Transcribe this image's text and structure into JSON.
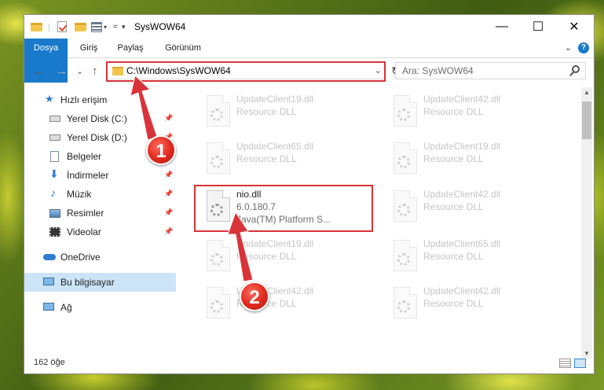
{
  "window": {
    "title": "SysWOW64"
  },
  "titlebar": {
    "minimize": "—",
    "maximize": "☐",
    "close": "✕"
  },
  "ribbon": {
    "tabs": [
      "Dosya",
      "Giriş",
      "Paylaş",
      "Görünüm"
    ],
    "help": "?",
    "collapse": "⌄"
  },
  "nav": {
    "back": "←",
    "forward": "→",
    "recent": "⌄",
    "up": "↑",
    "address": "C:\\Windows\\SysWOW64",
    "address_dropdown": "⌄",
    "refresh": "↻",
    "search_placeholder": "Ara: SysWOW64"
  },
  "sidebar": {
    "items": [
      {
        "label": "Hızlı erişim",
        "icon": "star-icon"
      },
      {
        "label": "Yerel Disk (C:)",
        "icon": "drive-icon",
        "pinned": true
      },
      {
        "label": "Yerel Disk (D:)",
        "icon": "drive-icon",
        "pinned": true
      },
      {
        "label": "Belgeler",
        "icon": "documents-icon",
        "pinned": true
      },
      {
        "label": "İndirmeler",
        "icon": "download-icon",
        "pinned": true
      },
      {
        "label": "Müzik",
        "icon": "music-icon",
        "pinned": true
      },
      {
        "label": "Resimler",
        "icon": "pictures-icon",
        "pinned": true
      },
      {
        "label": "Videolar",
        "icon": "videos-icon",
        "pinned": true
      },
      {
        "label": "OneDrive",
        "icon": "cloud-icon"
      },
      {
        "label": "Bu bilgisayar",
        "icon": "computer-icon",
        "selected": true
      },
      {
        "label": "Ağ",
        "icon": "network-icon"
      }
    ]
  },
  "files": {
    "left": [
      {
        "name": "UpdateClient19.dll",
        "desc": "Resource DLL"
      },
      {
        "name": "UpdateClient65.dll",
        "desc": "Resource DLL"
      },
      {
        "name": "nio.dll",
        "desc": "6.0.180.7",
        "desc2": "Java(TM) Platform S..."
      },
      {
        "name": "UpdateClient19.dll",
        "desc": "Resource DLL"
      },
      {
        "name": "UpdateClient42.dll",
        "desc": "Resource DLL"
      }
    ],
    "right": [
      {
        "name": "UpdateClient42.dll",
        "desc": "Resource DLL"
      },
      {
        "name": "UpdateClient19.dll",
        "desc": "Resource DLL"
      },
      {
        "name": "UpdateClient42.dll",
        "desc": "Resource DLL"
      },
      {
        "name": "UpdateClient65.dll",
        "desc": "Resource DLL"
      },
      {
        "name": "UpdateClient42.dll",
        "desc": "Resource DLL"
      }
    ]
  },
  "status": {
    "count": "162 öğe"
  },
  "annotations": {
    "marker1": "1",
    "marker2": "2",
    "color": "#d9333a"
  }
}
